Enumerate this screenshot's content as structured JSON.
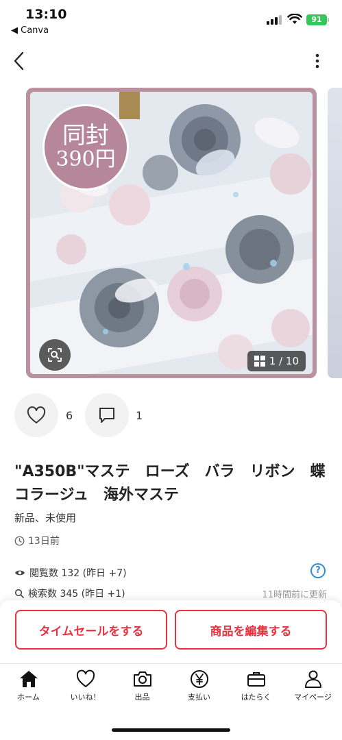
{
  "status_bar": {
    "time": "13:10",
    "back_app": "◀ Canva",
    "battery": "91"
  },
  "carousel": {
    "sale_line1": "同封",
    "sale_line2": "390円",
    "page_counter": "1 / 10"
  },
  "engagement": {
    "likes": "6",
    "comments": "1"
  },
  "item": {
    "title": "\"A350B\"マステ　ローズ　バラ　リボン　蝶　コラージュ　海外マステ",
    "condition": "新品、未使用",
    "posted": "13日前"
  },
  "stats": {
    "views": "閲覧数  132 (昨日 +7)",
    "searches": "検索数  345 (昨日 +1)",
    "help": "?",
    "updated": "11時間前に更新"
  },
  "actions": {
    "time_sale": "タイムセールをする",
    "edit_item": "商品を編集する"
  },
  "tabs": [
    {
      "label": "ホーム"
    },
    {
      "label": "いいね！"
    },
    {
      "label": "出品"
    },
    {
      "label": "支払い"
    },
    {
      "label": "はたらく"
    },
    {
      "label": "マイページ"
    }
  ],
  "colors": {
    "accent": "#e6323e",
    "frame": "#b9919f",
    "help": "#2a8bd6"
  }
}
